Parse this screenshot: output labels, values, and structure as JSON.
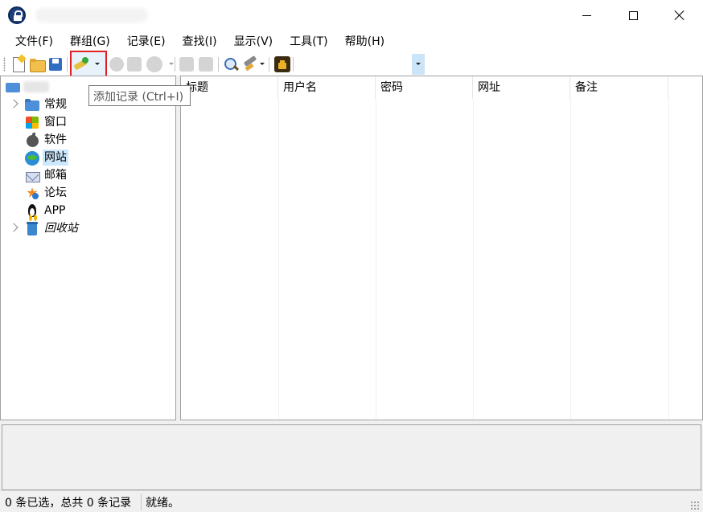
{
  "window": {
    "app_icon": "lock-icon",
    "minimize_icon": "minimize-icon",
    "maximize_icon": "maximize-icon",
    "close_icon": "close-icon"
  },
  "menu": {
    "items": [
      "文件(F)",
      "群组(G)",
      "记录(E)",
      "查找(I)",
      "显示(V)",
      "工具(T)",
      "帮助(H)"
    ]
  },
  "toolbar": {
    "tooltip": "添加记录 (Ctrl+I)",
    "highlight_color": "#e02020",
    "icons": [
      "new-database-icon",
      "open-database-icon",
      "save-icon",
      "add-entry-icon",
      "copy-username-icon",
      "copy-password-icon",
      "open-url-icon",
      "copy-entry-icon",
      "duplicate-entry-icon",
      "find-icon",
      "tools-icon",
      "lock-workspace-icon"
    ]
  },
  "tree": {
    "groups": [
      {
        "label": "常规",
        "icon": "folder-icon",
        "expandable": true
      },
      {
        "label": "窗口",
        "icon": "windows-icon",
        "expandable": false
      },
      {
        "label": "软件",
        "icon": "apple-icon",
        "expandable": false
      },
      {
        "label": "网站",
        "icon": "globe-icon",
        "expandable": false,
        "selected": true
      },
      {
        "label": "邮箱",
        "icon": "mail-icon",
        "expandable": false
      },
      {
        "label": "论坛",
        "icon": "star-icon",
        "expandable": false
      },
      {
        "label": "APP",
        "icon": "penguin-icon",
        "expandable": false
      },
      {
        "label": "回收站",
        "icon": "recycle-bin-icon",
        "expandable": true,
        "italic": true
      }
    ]
  },
  "entries": {
    "columns": [
      "标题",
      "用户名",
      "密码",
      "网址",
      "备注"
    ]
  },
  "status": {
    "selection": "0 条已选，总共 0 条记录",
    "state": "就绪。"
  }
}
